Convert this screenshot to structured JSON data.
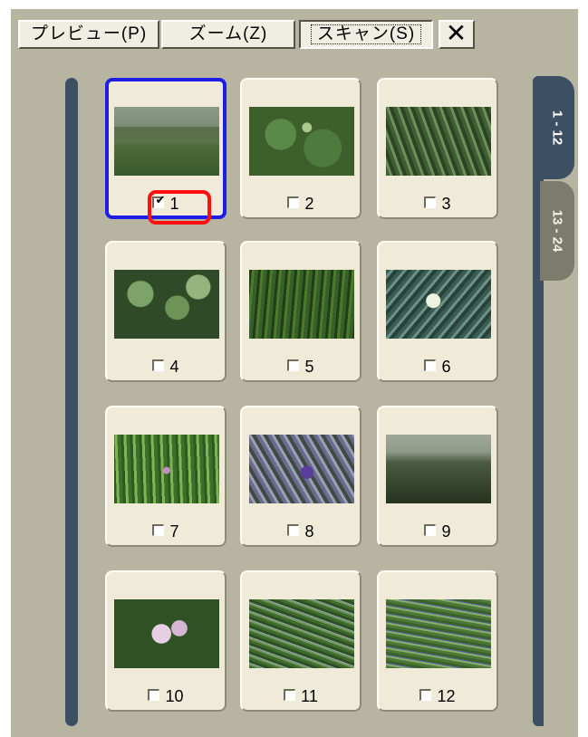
{
  "toolbar": {
    "preview_label": "プレビュー(P)",
    "zoom_label": "ズーム(Z)",
    "scan_label": "スキャン(S)",
    "close_label": "✕"
  },
  "tabs": [
    {
      "label": "1 - 12",
      "active": true
    },
    {
      "label": "13 - 24",
      "active": false
    }
  ],
  "frames": [
    {
      "number": "1",
      "checked": true,
      "selected": true
    },
    {
      "number": "2",
      "checked": false
    },
    {
      "number": "3",
      "checked": false
    },
    {
      "number": "4",
      "checked": false
    },
    {
      "number": "5",
      "checked": false
    },
    {
      "number": "6",
      "checked": false
    },
    {
      "number": "7",
      "checked": false
    },
    {
      "number": "8",
      "checked": false
    },
    {
      "number": "9",
      "checked": false
    },
    {
      "number": "10",
      "checked": false
    },
    {
      "number": "11",
      "checked": false
    },
    {
      "number": "12",
      "checked": false
    }
  ],
  "checkmark": "✔",
  "colors": {
    "selection_border": "#1d1de6",
    "highlight_ring": "#ff1010",
    "rail": "#3c4f63",
    "panel_bg": "#b7b5a2"
  }
}
